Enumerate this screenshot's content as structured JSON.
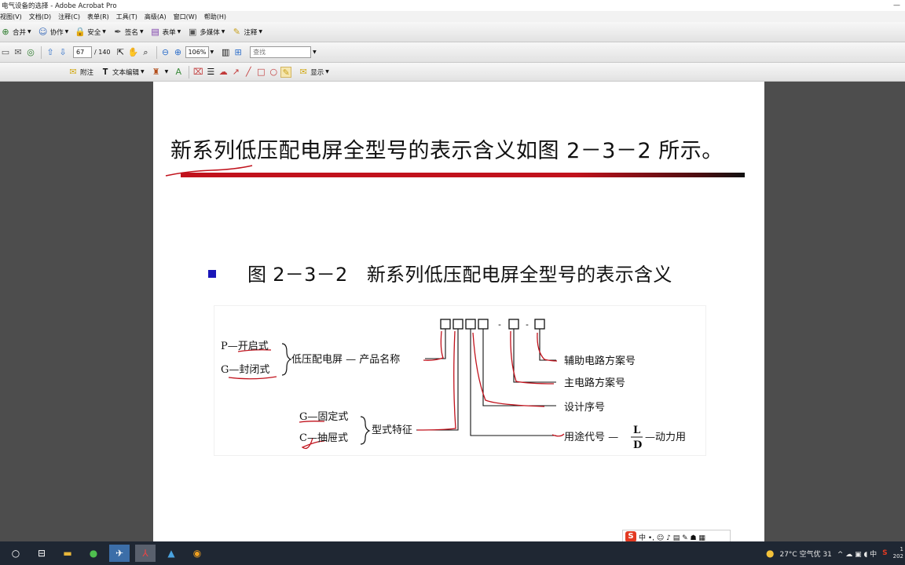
{
  "window": {
    "title": "电气设备的选择 - Adobe Acrobat Pro",
    "minimize": "—"
  },
  "menu": [
    "视图(V)",
    "文档(D)",
    "注释(C)",
    "表单(R)",
    "工具(T)",
    "高级(A)",
    "窗口(W)",
    "帮助(H)"
  ],
  "toolbar1": {
    "merge": "合并",
    "collab": "协作",
    "secure": "安全",
    "sign": "签名",
    "forms": "表单",
    "media": "多媒体",
    "comment": "注释"
  },
  "toolbar2": {
    "page_current": "67",
    "page_total": "/ 140",
    "zoom": "106%",
    "search_placeholder": "查找"
  },
  "toolbar3": {
    "note": "附注",
    "text_edit": "文本编辑",
    "show": "显示"
  },
  "slide": {
    "heading": "新系列低压配电屏全型号的表示含义如图 2－3－2 所示。",
    "caption": "图 2－3－2　新系列低压配电屏全型号的表示含义"
  },
  "diagram": {
    "p_open": "P—开启式",
    "g_closed": "G—封闭式",
    "low_voltage": "低压配电屏 — 产品名称",
    "g_fixed": "G—固定式",
    "c_drawer": "C—抽屉式",
    "type_feature": "型式特征",
    "aux_circuit": "辅助电路方案号",
    "main_circuit": "主电路方案号",
    "design_no": "设计序号",
    "usage_code": "用途代号 —",
    "code_L": "L",
    "code_D": "D",
    "power_use": "—动力用",
    "dash1": "-",
    "dash2": "-"
  },
  "ime": {
    "logo": "S",
    "label": "中 •, ☺ ♪ ▤ ✎ ☗ ▦"
  },
  "taskbar": {
    "weather": "27°C 空气优 31",
    "tray": "^ ☁ ▣ ◖ 中",
    "ime": "S",
    "clock_top": "1",
    "clock_bot": "202"
  }
}
